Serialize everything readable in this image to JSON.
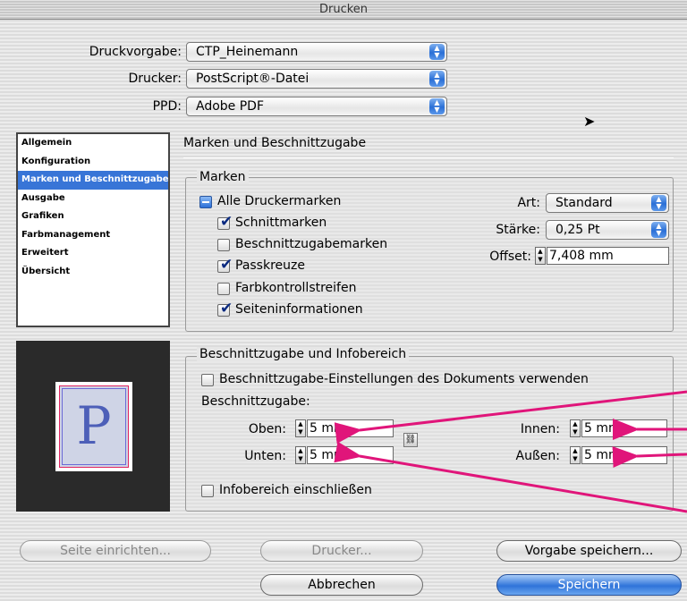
{
  "window": {
    "title": "Drucken"
  },
  "top": {
    "preset_label": "Druckvorgabe:",
    "preset_value": "CTP_Heinemann",
    "printer_label": "Drucker:",
    "printer_value": "PostScript®-Datei",
    "ppd_label": "PPD:",
    "ppd_value": "Adobe PDF"
  },
  "sidebar": {
    "items": [
      {
        "label": "Allgemein"
      },
      {
        "label": "Konfiguration"
      },
      {
        "label": "Marken und Beschnittzugabe"
      },
      {
        "label": "Ausgabe"
      },
      {
        "label": "Grafiken"
      },
      {
        "label": "Farbmanagement"
      },
      {
        "label": "Erweitert"
      },
      {
        "label": "Übersicht"
      }
    ],
    "selected_index": 2
  },
  "panel": {
    "title": "Marken und Beschnittzugabe"
  },
  "marks": {
    "group_title": "Marken",
    "all_label": "Alle Druckermarken",
    "crop_label": "Schnittmarken",
    "bleed_marks_label": "Beschnittzugabemarken",
    "registration_label": "Passkreuze",
    "color_bars_label": "Farbkontrollstreifen",
    "page_info_label": "Seiteninformationen",
    "type_label": "Art:",
    "type_value": "Standard",
    "weight_label": "Stärke:",
    "weight_value": "0,25 Pt",
    "offset_label": "Offset:",
    "offset_value": "7,408 mm"
  },
  "bleed": {
    "group_title": "Beschnittzugabe und Infobereich",
    "use_doc_label": "Beschnittzugabe-Einstellungen des Dokuments verwenden",
    "bleed_heading": "Beschnittzugabe:",
    "top_label": "Oben:",
    "top_value": "5 mm",
    "bottom_label": "Unten:",
    "bottom_value": "5 mm",
    "inside_label": "Innen:",
    "inside_value": "5 mm",
    "outside_label": "Außen:",
    "outside_value": "5 mm",
    "slug_label": "Infobereich einschließen"
  },
  "preview": {
    "letter": "P"
  },
  "buttons": {
    "page_setup": "Seite einrichten...",
    "printer": "Drucker...",
    "save_preset": "Vorgabe speichern...",
    "cancel": "Abbrechen",
    "save": "Speichern"
  },
  "colors": {
    "accent": "#3875d7",
    "annotation_arrow": "#e0157a"
  }
}
